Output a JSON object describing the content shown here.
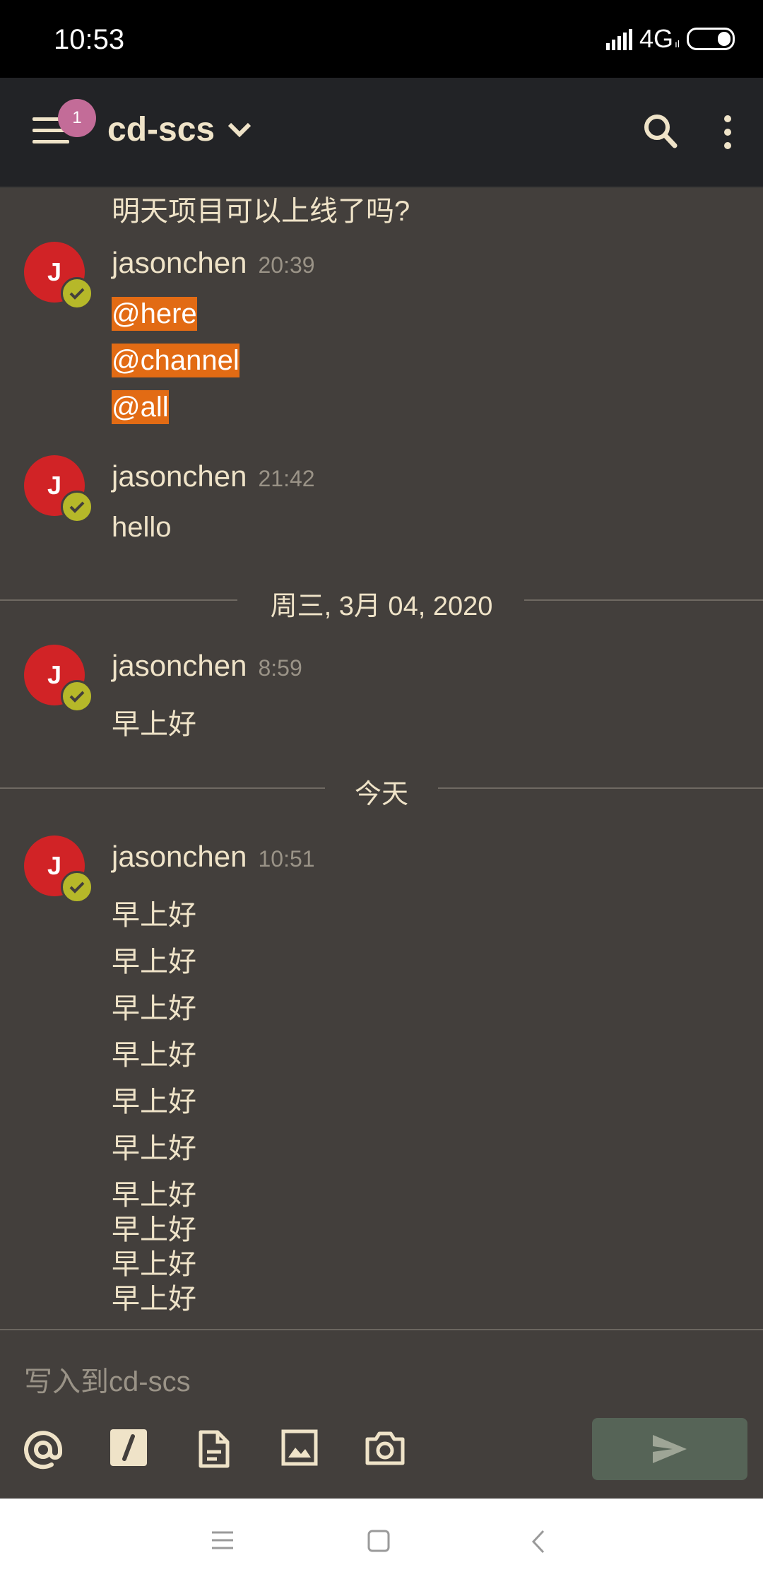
{
  "status_bar": {
    "time": "10:53",
    "network": "4G",
    "network_sub": "ıl"
  },
  "header": {
    "channel_name": "cd-scs",
    "unread_badge": "1"
  },
  "messages": {
    "continued_text": "明天项目可以上线了吗?",
    "groups": [
      {
        "avatar_initial": "J",
        "username": "jasonchen",
        "time": "20:39",
        "lines": [
          "@here",
          "@channel",
          "@all"
        ]
      },
      {
        "avatar_initial": "J",
        "username": "jasonchen",
        "time": "21:42",
        "lines": [
          "hello"
        ]
      },
      {
        "avatar_initial": "J",
        "username": "jasonchen",
        "time": "8:59",
        "lines": [
          "早上好"
        ]
      },
      {
        "avatar_initial": "J",
        "username": "jasonchen",
        "time": "10:51",
        "lines": [
          "早上好",
          "早上好",
          "早上好",
          "早上好",
          "早上好",
          "早上好",
          "早上好",
          "早上好",
          "早上好",
          "早上好"
        ]
      }
    ],
    "separators": [
      "周三, 3月 04, 2020",
      "今天"
    ]
  },
  "composer": {
    "placeholder": "写入到cd-scs"
  },
  "colors": {
    "background": "#433f3c",
    "header": "#222326",
    "text": "#efe3c8",
    "mention_highlight": "#e26b14",
    "avatar": "#d12326",
    "online_status": "#b6b829",
    "badge": "#c36c98",
    "send_button": "#566457"
  }
}
